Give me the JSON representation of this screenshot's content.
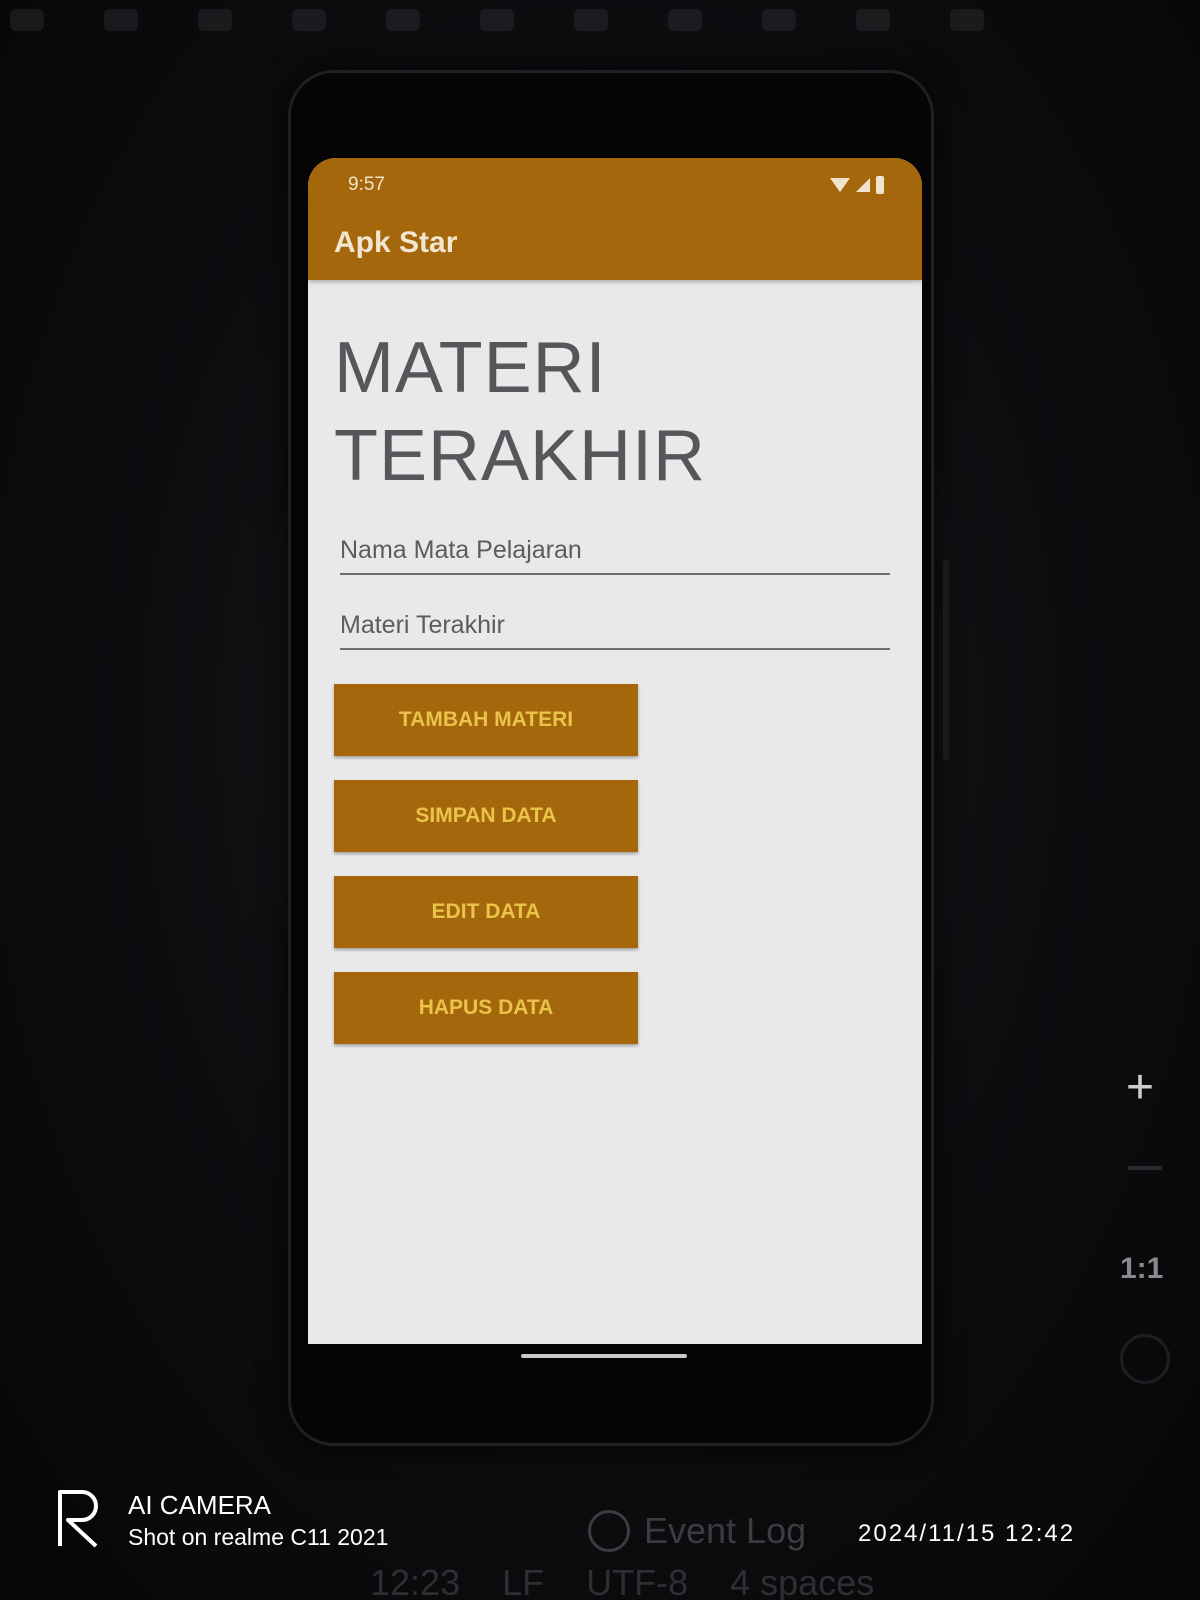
{
  "status_bar": {
    "time": "9:57",
    "icons": [
      "wifi-icon",
      "signal-icon",
      "battery-icon"
    ]
  },
  "app_bar": {
    "title": "Apk Star"
  },
  "main": {
    "heading": "MATERI\nTERAKHIR",
    "fields": {
      "subject": {
        "placeholder": "Nama Mata Pelajaran",
        "value": ""
      },
      "material": {
        "placeholder": "Materi Terakhir",
        "value": ""
      }
    },
    "buttons": {
      "add": "TAMBAH MATERI",
      "save": "SIMPAN DATA",
      "edit": "EDIT DATA",
      "delete": "HAPUS DATA"
    }
  },
  "emulator_controls": {
    "zoom_in": "+",
    "actual_size": "1:1"
  },
  "ide_footer": {
    "event_log": "Event Log",
    "line_col": "12:23",
    "line_ending": "LF",
    "encoding": "UTF-8",
    "indent": "4 spaces"
  },
  "camera_watermark": {
    "brand": "AI CAMERA",
    "shot_on": "Shot on realme C11 2021",
    "datetime": "2024/11/15  12:42"
  },
  "colors": {
    "primary": "#a5670b",
    "button_text": "#e9c34a",
    "background": "#e9e9ea",
    "heading_text": "#55575a"
  }
}
